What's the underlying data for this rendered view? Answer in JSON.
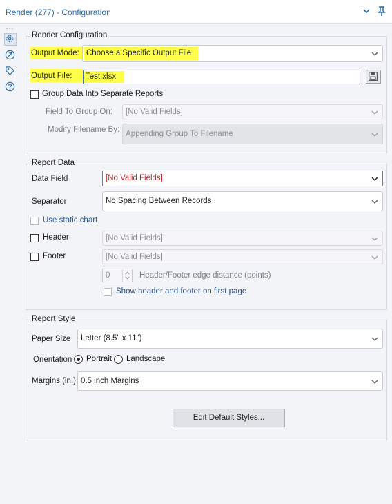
{
  "titlebar": {
    "title": "Render (277) - Configuration"
  },
  "toolbar": {
    "more": "...",
    "icons": [
      "gear-icon",
      "connection-icon",
      "tag-icon",
      "help-icon"
    ]
  },
  "render_config": {
    "group_title": "Render Configuration",
    "output_mode_label": "Output Mode:",
    "output_mode_value": "Choose a Specific Output File",
    "output_file_label": "Output File:",
    "output_file_value": "Test.xlsx",
    "group_checkbox_label": "Group Data Into Separate Reports",
    "field_to_group_label": "Field To Group On:",
    "field_to_group_value": "[No Valid Fields]",
    "modify_filename_label": "Modify Filename By:",
    "modify_filename_value": "Appending Group To Filename"
  },
  "report_data": {
    "group_title": "Report Data",
    "data_field_label": "Data Field",
    "data_field_value": "[No Valid Fields]",
    "separator_label": "Separator",
    "separator_value": "No Spacing Between Records",
    "static_chart_label": "Use static chart",
    "header_label": "Header",
    "header_value": "[No Valid Fields]",
    "footer_label": "Footer",
    "footer_value": "[No Valid Fields]",
    "edge_distance_value": "0",
    "edge_distance_label": "Header/Footer edge distance (points)",
    "show_first_page_label": "Show header and footer on first page"
  },
  "report_style": {
    "group_title": "Report Style",
    "paper_size_label": "Paper Size",
    "paper_size_value": "Letter (8.5\" x 11\")",
    "orientation_label": "Orientation",
    "portrait_label": "Portrait",
    "landscape_label": "Landscape",
    "orientation_selected": "Portrait",
    "margins_label": "Margins (in.)",
    "margins_value": "0.5 inch Margins",
    "edit_styles_label": "Edit Default Styles..."
  },
  "colors": {
    "highlight": "#ffff47",
    "error_text": "#c0292b",
    "title_text": "#2a6db0"
  }
}
